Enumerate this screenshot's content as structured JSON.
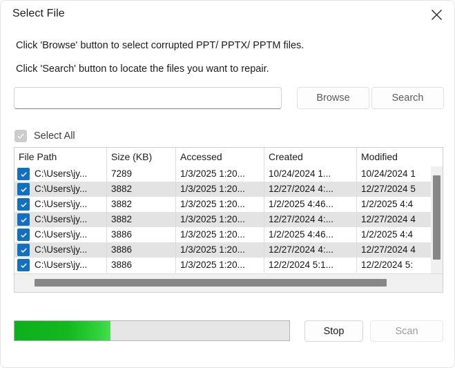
{
  "window": {
    "title": "Select File",
    "close_icon": "close-icon"
  },
  "instructions": {
    "line1": "Click 'Browse' button to select corrupted PPT/ PPTX/ PPTM files.",
    "line2": "Click 'Search' button to locate the files you want to repair."
  },
  "path_row": {
    "input_value": "",
    "input_placeholder": "",
    "browse_label": "Browse",
    "search_label": "Search"
  },
  "select_all": {
    "label": "Select All",
    "checked": true,
    "enabled": false
  },
  "table": {
    "columns": [
      "File Path",
      "Size (KB)",
      "Accessed",
      "Created",
      "Modified"
    ],
    "rows": [
      {
        "checked": true,
        "file_path": "C:\\Users\\jy...",
        "size_kb": "7289",
        "accessed": "1/3/2025 1:20...",
        "created": "10/24/2024 1...",
        "modified": "10/24/2024 1"
      },
      {
        "checked": true,
        "file_path": "C:\\Users\\jy...",
        "size_kb": "3882",
        "accessed": "1/3/2025 1:20...",
        "created": "12/27/2024 4:...",
        "modified": "12/27/2024 5"
      },
      {
        "checked": true,
        "file_path": "C:\\Users\\jy...",
        "size_kb": "3882",
        "accessed": "1/3/2025 1:20...",
        "created": "1/2/2025 4:46...",
        "modified": "1/2/2025 4:4"
      },
      {
        "checked": true,
        "file_path": "C:\\Users\\jy...",
        "size_kb": "3882",
        "accessed": "1/3/2025 1:20...",
        "created": "12/27/2024 4:...",
        "modified": "12/27/2024 4"
      },
      {
        "checked": true,
        "file_path": "C:\\Users\\jy...",
        "size_kb": "3886",
        "accessed": "1/3/2025 1:20...",
        "created": "1/2/2025 4:46...",
        "modified": "1/2/2025 4:4"
      },
      {
        "checked": true,
        "file_path": "C:\\Users\\jy...",
        "size_kb": "3886",
        "accessed": "1/3/2025 1:20...",
        "created": "12/27/2024 4:...",
        "modified": "12/27/2024 4"
      },
      {
        "checked": true,
        "file_path": "C:\\Users\\jy...",
        "size_kb": "3886",
        "accessed": "1/3/2025 1:20...",
        "created": "12/2/2024 5:1...",
        "modified": "12/2/2024 5:"
      }
    ]
  },
  "footer": {
    "progress_percent": 35,
    "stop_label": "Stop",
    "scan_label": "Scan",
    "scan_enabled": false
  },
  "colors": {
    "accent_checkbox": "#1370bf",
    "progress_green": "#11b81f",
    "scrollbar_thumb": "#878787",
    "row_alt": "#e3e3e3"
  }
}
